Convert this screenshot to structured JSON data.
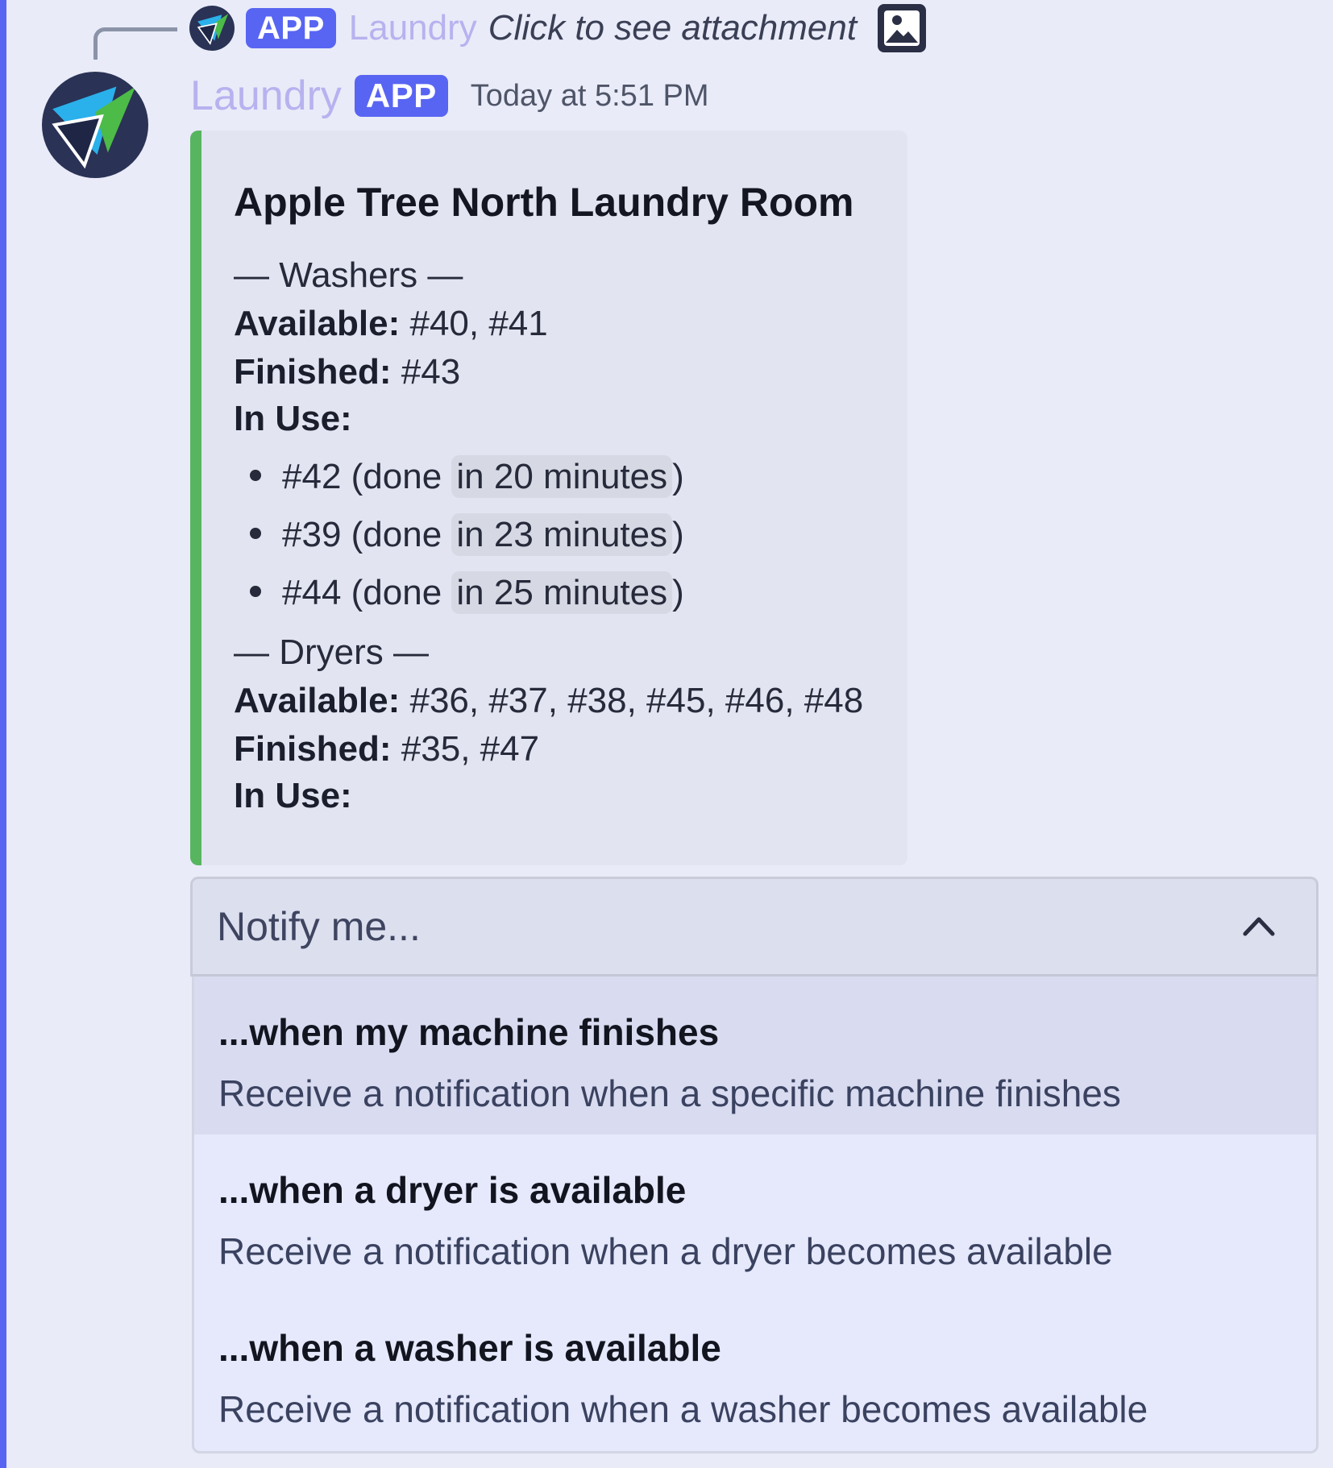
{
  "reply": {
    "app_name": "Laundry",
    "badge": "APP",
    "text": "Click to see attachment",
    "attachment_icon": "image-icon"
  },
  "message": {
    "author": "Laundry",
    "badge": "APP",
    "timestamp": "Today at 5:51 PM",
    "avatar_icon": "laundry-logo"
  },
  "embed": {
    "accent_color": "#57b560",
    "title": "Apple Tree North Laundry Room",
    "washers": {
      "heading": "— Washers —",
      "available_label": "Available:",
      "available": "#40, #41",
      "finished_label": "Finished:",
      "finished": "#43",
      "in_use_label": "In Use:",
      "in_use": [
        {
          "machine": "#42 (done",
          "eta": "in 20 minutes",
          "close": ")"
        },
        {
          "machine": "#39 (done",
          "eta": "in 23 minutes",
          "close": ")"
        },
        {
          "machine": "#44 (done",
          "eta": "in 25 minutes",
          "close": ")"
        }
      ]
    },
    "dryers": {
      "heading": "— Dryers —",
      "available_label": "Available:",
      "available": "#36, #37, #38, #45, #46, #48",
      "finished_label": "Finished:",
      "finished": "#35, #47",
      "in_use_label": "In Use:"
    }
  },
  "select": {
    "placeholder": "Notify me...",
    "expanded": true,
    "chevron_icon": "chevron-up-icon",
    "options": [
      {
        "title": "...when my machine finishes",
        "description": "Receive a notification when a specific machine finishes",
        "highlighted": true
      },
      {
        "title": "...when a dryer is available",
        "description": "Receive a notification when a dryer becomes available",
        "highlighted": false
      },
      {
        "title": "...when a washer is available",
        "description": "Receive a notification when a washer becomes available",
        "highlighted": false
      }
    ]
  },
  "colors": {
    "brand": "#5865f2",
    "background": "#e9ebf8",
    "app_name": "#b7b2ef"
  }
}
